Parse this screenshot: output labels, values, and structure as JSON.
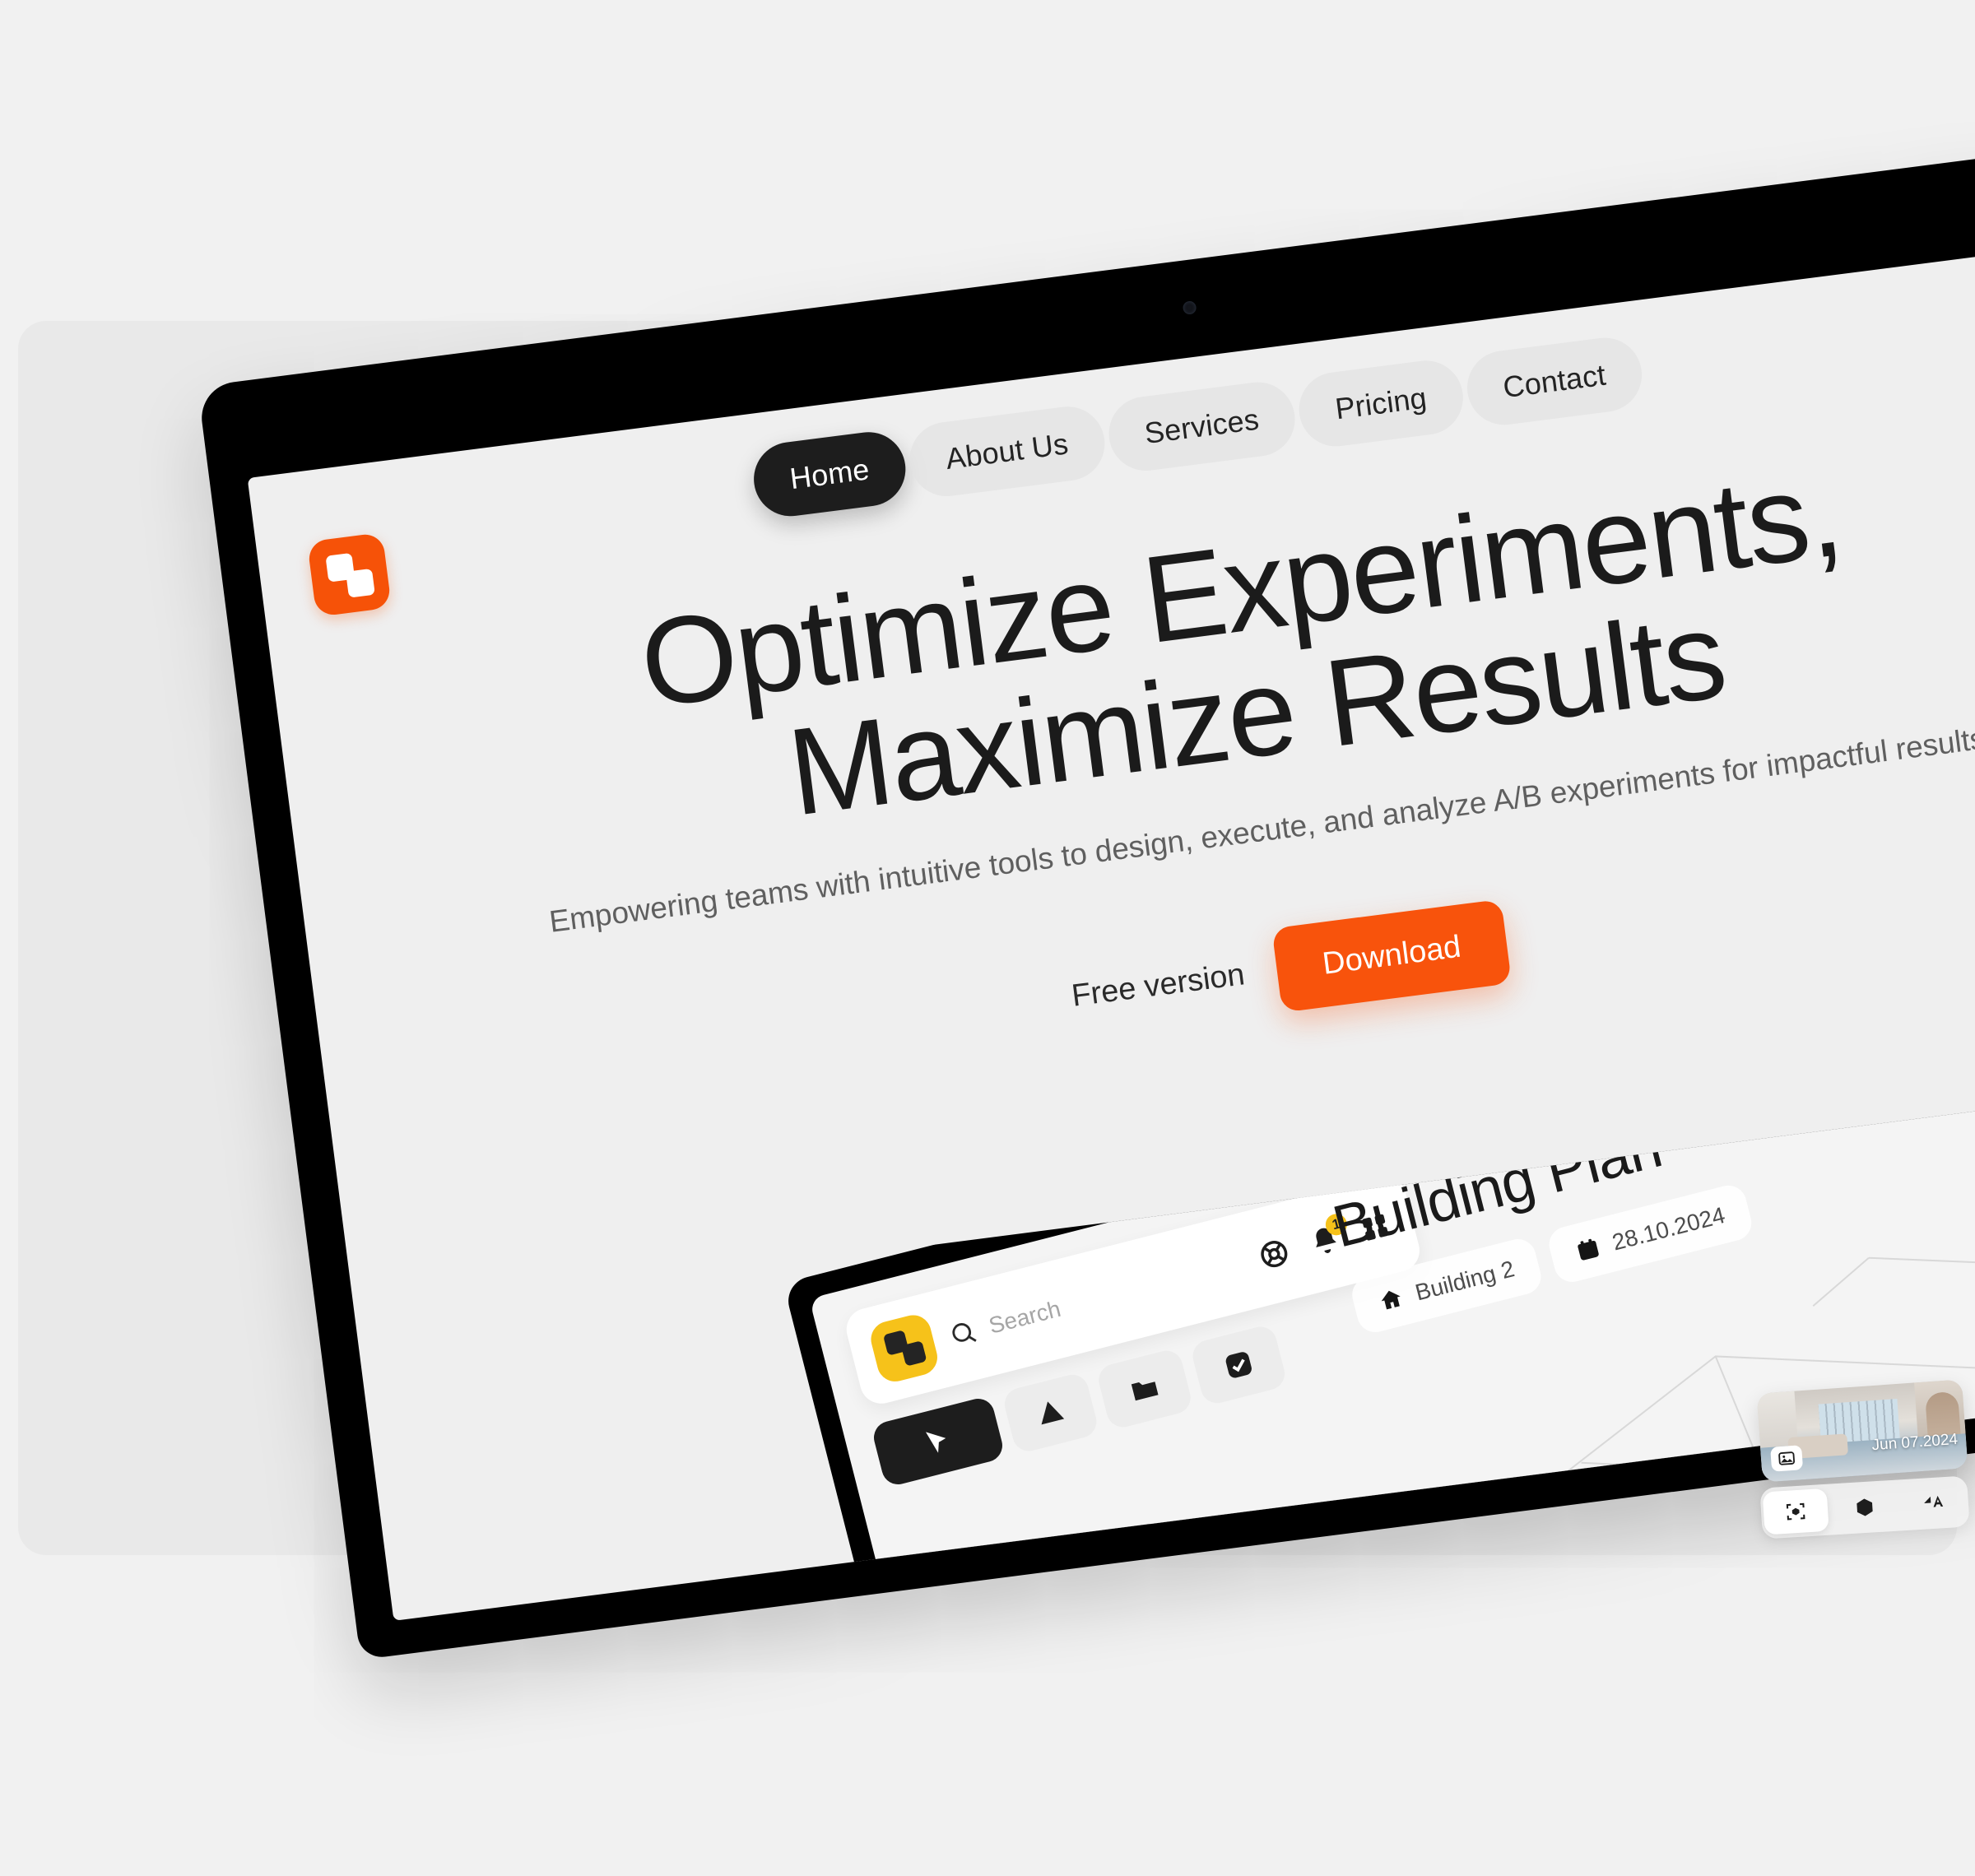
{
  "brand": {
    "logo_icon": "two-squares-logo-icon",
    "accent_color": "#f8530c",
    "logo_color": "#f65208"
  },
  "nav": {
    "items": [
      {
        "label": "Home",
        "active": true
      },
      {
        "label": "About Us",
        "active": false
      },
      {
        "label": "Services",
        "active": false
      },
      {
        "label": "Pricing",
        "active": false
      },
      {
        "label": "Contact",
        "active": false
      }
    ]
  },
  "hero": {
    "headline_line1": "Optimize Experiments,",
    "headline_line2": "Maximize Results",
    "subtitle": "Empowering teams with intuitive tools to design, execute, and analyze A/B experiments for impactful results.",
    "free_version_label": "Free version",
    "download_label": "Download"
  },
  "app_mockup": {
    "logo_icon": "two-squares-logo-icon",
    "logo_color": "#f6c21a",
    "search_placeholder": "Search",
    "topbar_icons": [
      {
        "name": "help-icon"
      },
      {
        "name": "bell-icon",
        "badge": "1"
      },
      {
        "name": "grid-icon"
      }
    ],
    "plan_title": "Building Plan",
    "plan_chips": [
      {
        "icon": "home-icon",
        "label": "Building 2"
      },
      {
        "icon": "calendar-icon",
        "label": "28.10.2024"
      }
    ],
    "toolbar_items": [
      {
        "name": "cursor-tool",
        "active": true
      },
      {
        "name": "shape-tool",
        "active": false
      },
      {
        "name": "folder-tool",
        "active": false
      },
      {
        "name": "check-tool",
        "active": false
      }
    ]
  },
  "pano_panel": {
    "date_label": "Jun 07.2024",
    "image_badge_icon": "image-icon",
    "tools": [
      {
        "name": "scan-cube-icon",
        "active": true
      },
      {
        "name": "cube-icon",
        "active": false
      },
      {
        "name": "measure-text-icon",
        "active": false
      }
    ]
  }
}
